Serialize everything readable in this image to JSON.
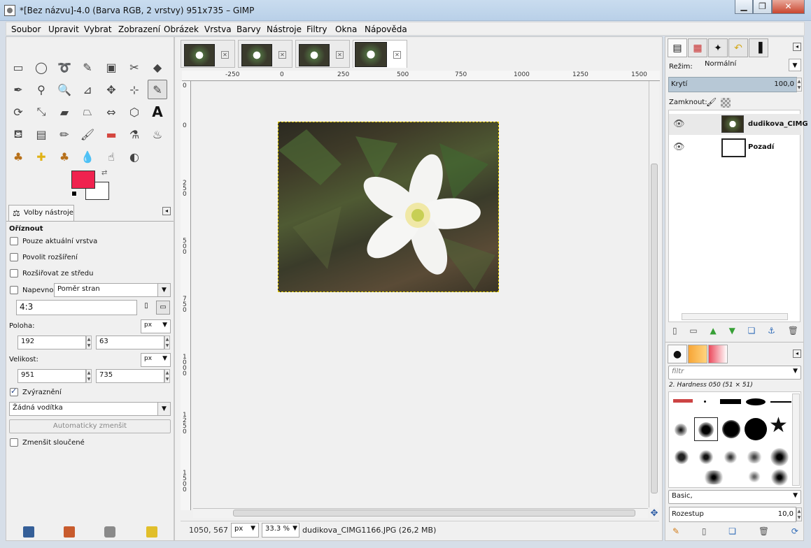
{
  "window": {
    "title": "*[Bez názvu]-4.0 (Barva RGB, 2 vrstvy) 951x735 – GIMP"
  },
  "menu": {
    "items": [
      "Soubor",
      "Upravit",
      "Vybrat",
      "Zobrazení",
      "Obrázek",
      "Vrstva",
      "Barvy",
      "Nástroje",
      "Filtry",
      "Okna",
      "Nápověda"
    ]
  },
  "toolbox": {
    "tool_icons": [
      "rect-select-icon",
      "ellipse-select-icon",
      "free-select-icon",
      "fuzzy-select-icon",
      "by-color-select-icon",
      "scissors-select-icon",
      "foreground-select-icon",
      "paths-icon",
      "color-picker-icon",
      "zoom-icon",
      "measure-icon",
      "move-icon",
      "align-icon",
      "crop-icon",
      "rotate-icon",
      "scale-icon",
      "shear-icon",
      "perspective-icon",
      "flip-icon",
      "cage-transform-icon",
      "text-icon",
      "bucket-fill-icon",
      "blend-icon",
      "pencil-icon",
      "paintbrush-icon",
      "eraser-icon",
      "airbrush-icon",
      "ink-icon",
      "clone-icon",
      "heal-icon",
      "perspective-clone-icon",
      "blur-icon",
      "smudge-icon",
      "dodge-burn-icon"
    ],
    "foreground_color": "#f0224f",
    "background_color": "#ffffff"
  },
  "tool_options": {
    "tab_label": "Volby nástroje",
    "section_title": "Oříznout",
    "only_current_layer_label": "Pouze aktuální vrstva",
    "allow_growing_label": "Povolit rozšíření",
    "expand_from_center_label": "Rozšiřovat ze středu",
    "fixed_label": "Napevno:",
    "fixed_option": "Poměr stran",
    "ratio_value": "4:3",
    "position_label": "Poloha:",
    "position_unit": "px",
    "position_x": "192",
    "position_y": "63",
    "size_label": "Velikost:",
    "size_unit": "px",
    "size_w": "951",
    "size_h": "735",
    "highlight_label": "Zvýraznění",
    "guides_value": "Žádná vodítka",
    "auto_shrink_label": "Automaticky zmenšit",
    "shrink_merged_label": "Zmenšit sloučené"
  },
  "rulers": {
    "h_labels": [
      "-250",
      "0",
      "250",
      "500",
      "750",
      "1000",
      "1250",
      "1500"
    ],
    "v_labels": [
      "0",
      "0",
      "250",
      "500",
      "750",
      "1000",
      "1250",
      "1500"
    ]
  },
  "status": {
    "coords": "1050, 567",
    "unit": "px",
    "zoom": "33.3 %",
    "filename": "dudikova_CIMG1166.JPG (26,2 MB)"
  },
  "layers": {
    "mode_label": "Režim:",
    "mode_value": "Normální",
    "opacity_label": "Krytí",
    "opacity_value": "100,0",
    "lock_label": "Zamknout:",
    "items": [
      {
        "name": "dudikova_CIMG"
      },
      {
        "name": "Pozadí"
      }
    ]
  },
  "brushes": {
    "filter_placeholder": "filtr",
    "selected_brush": "2. Hardness 050 (51 × 51)",
    "preset_tag": "Basic,",
    "spacing_label": "Rozestup",
    "spacing_value": "10,0"
  }
}
